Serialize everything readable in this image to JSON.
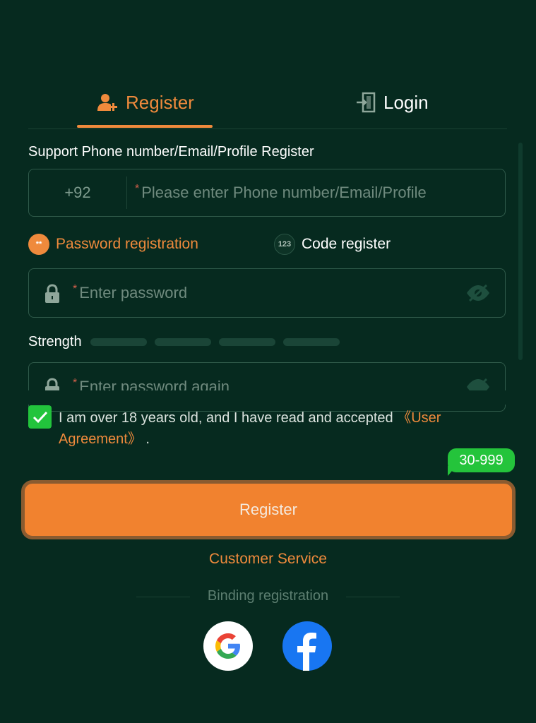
{
  "tabs": {
    "register_label": "Register",
    "login_label": "Login"
  },
  "form": {
    "support_label": "Support Phone number/Email/Profile Register",
    "phone_prefix": "+92",
    "required_mark": "*",
    "phone_placeholder": "Please enter Phone number/Email/Profile",
    "password_placeholder": "Enter password",
    "confirm_placeholder": "Enter password again",
    "strength_label": "Strength"
  },
  "modes": {
    "password_label": "Password registration",
    "password_badge": "**",
    "code_label": "Code register",
    "code_badge": "123"
  },
  "agreement": {
    "text": "I am over 18 years old, and I have read and accepted ",
    "link": "《User Agreement》",
    "suffix": " ."
  },
  "bonus_bubble": "30-999",
  "actions": {
    "register_button": "Register",
    "customer_service": "Customer Service"
  },
  "binding": {
    "label": "Binding registration"
  },
  "colors": {
    "background": "#062a1f",
    "accent": "#ef8a3c",
    "check": "#22c43c",
    "facebook": "#1876f2"
  }
}
